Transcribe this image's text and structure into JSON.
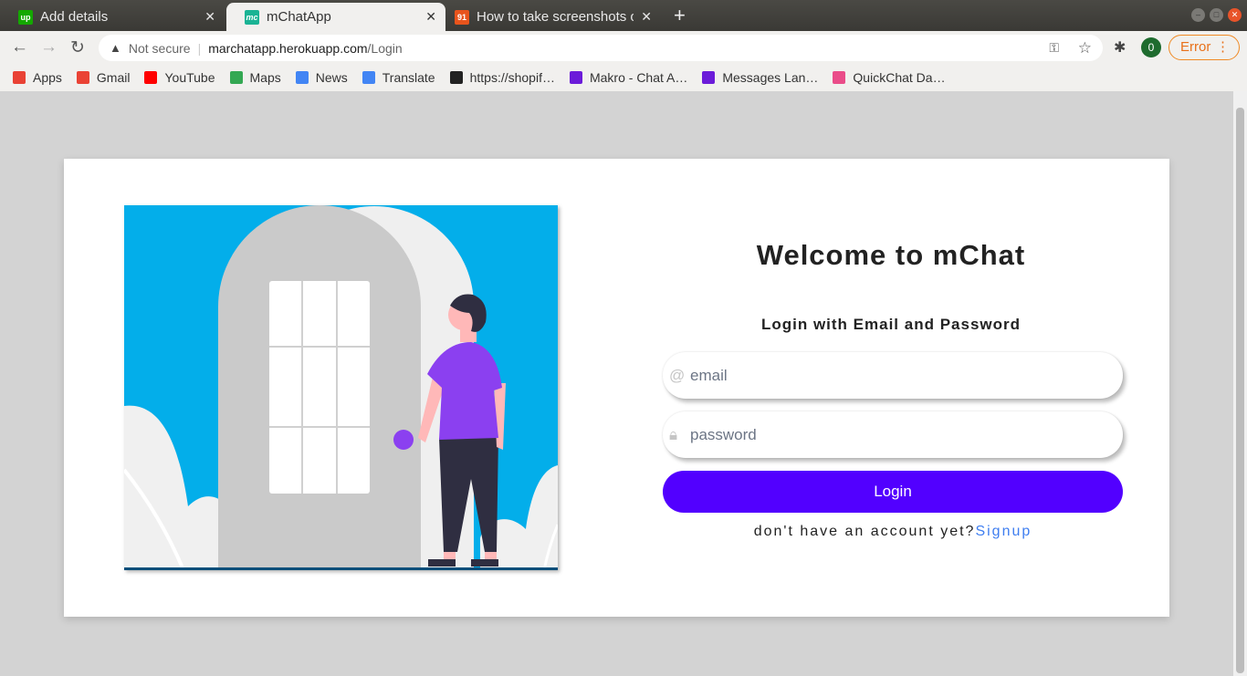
{
  "tabs": [
    {
      "title": "Add details",
      "icon": "upwork-icon",
      "fav": "up",
      "color": "#14a800"
    },
    {
      "title": "mChatApp",
      "icon": "mchat-icon",
      "fav": "mc",
      "color": "#1ab394"
    },
    {
      "title": "How to take screenshots o",
      "icon": "91-icon",
      "fav": "91",
      "color": "#e8541c"
    }
  ],
  "address": {
    "security": "Not secure",
    "host": "marchatapp.herokuapp.com",
    "path": "/Login"
  },
  "profile": "0",
  "error_label": "Error",
  "bookmarks": [
    {
      "label": "Apps",
      "color": "#e94235"
    },
    {
      "label": "Gmail",
      "color": "#ea4335"
    },
    {
      "label": "YouTube",
      "color": "#ff0000"
    },
    {
      "label": "Maps",
      "color": "#34a853"
    },
    {
      "label": "News",
      "color": "#4285f4"
    },
    {
      "label": "Translate",
      "color": "#4285f4"
    },
    {
      "label": "https://shopif…",
      "color": "#222"
    },
    {
      "label": "Makro - Chat A…",
      "color": "#6b1bd9"
    },
    {
      "label": "Messages Lan…",
      "color": "#6b1bd9"
    },
    {
      "label": "QuickChat Da…",
      "color": "#ea4c89"
    }
  ],
  "login": {
    "title": "Welcome to mChat",
    "subtitle": "Login with Email and Password",
    "email_placeholder": "email",
    "password_placeholder": "password",
    "button": "Login",
    "signup_prompt": "don't have an account yet?",
    "signup_link": "Signup"
  }
}
